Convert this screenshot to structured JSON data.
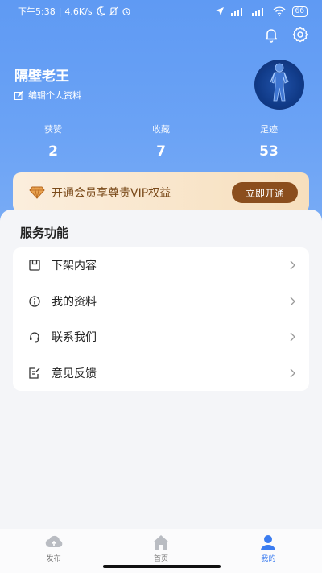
{
  "status_bar": {
    "time": "下午5:38",
    "speed": "4.6K/s",
    "battery": "66"
  },
  "profile": {
    "username": "隔壁老王",
    "edit_label": "编辑个人资料"
  },
  "stats": [
    {
      "label": "获赞",
      "value": "2"
    },
    {
      "label": "收藏",
      "value": "7"
    },
    {
      "label": "足迹",
      "value": "53"
    }
  ],
  "vip": {
    "text": "开通会员享尊贵VIP权益",
    "button": "立即开通"
  },
  "services": {
    "title": "服务功能",
    "items": [
      {
        "label": "下架内容",
        "icon": "archive-icon"
      },
      {
        "label": "我的资料",
        "icon": "info-icon"
      },
      {
        "label": "联系我们",
        "icon": "headset-icon"
      },
      {
        "label": "意见反馈",
        "icon": "feedback-icon"
      }
    ]
  },
  "tabbar": {
    "tabs": [
      {
        "label": "发布",
        "icon": "cloud-upload-icon",
        "active": false
      },
      {
        "label": "首页",
        "icon": "home-icon",
        "active": false
      },
      {
        "label": "我的",
        "icon": "user-icon",
        "active": true
      }
    ]
  },
  "colors": {
    "header": "#6aa2f5",
    "vip_button": "#8b4e1d",
    "active_tab": "#3b7cf0"
  }
}
